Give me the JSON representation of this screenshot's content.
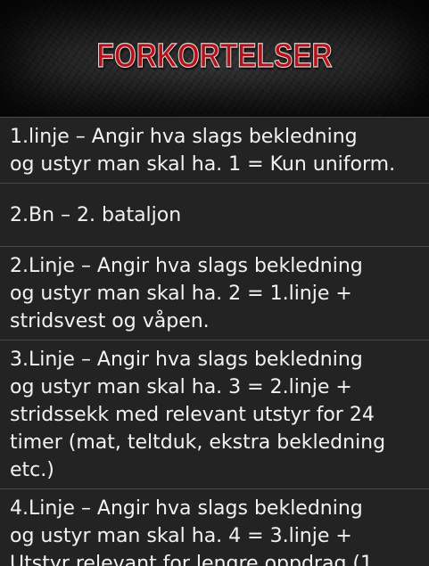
{
  "header": {
    "title": "FORKORTELSER"
  },
  "items": [
    {
      "text": "1.linje – Angir hva slags bekledning\nog ustyr man skal ha. 1 = Kun uniform."
    },
    {
      "text": "2.Bn – 2. bataljon"
    },
    {
      "text": "2.Linje – Angir hva slags bekledning\nog ustyr man skal ha. 2 = 1.linje +\nstridsvest og våpen."
    },
    {
      "text": "3.Linje – Angir hva slags bekledning\nog ustyr man skal ha. 3 = 2.linje +\nstridssekk med relevant utstyr for 24\ntimer (mat, teltduk, ekstra bekledning\netc.)"
    },
    {
      "text": "4.Linje – Angir hva slags bekledning\nog ustyr man skal ha. 4 = 3.linje +\nUtstyr relevant for lengre oppdrag (1"
    }
  ],
  "colors": {
    "title_red": "#b3121a",
    "background": "#232323",
    "divider": "#4a4a4a",
    "text": "#f2f2f2"
  }
}
